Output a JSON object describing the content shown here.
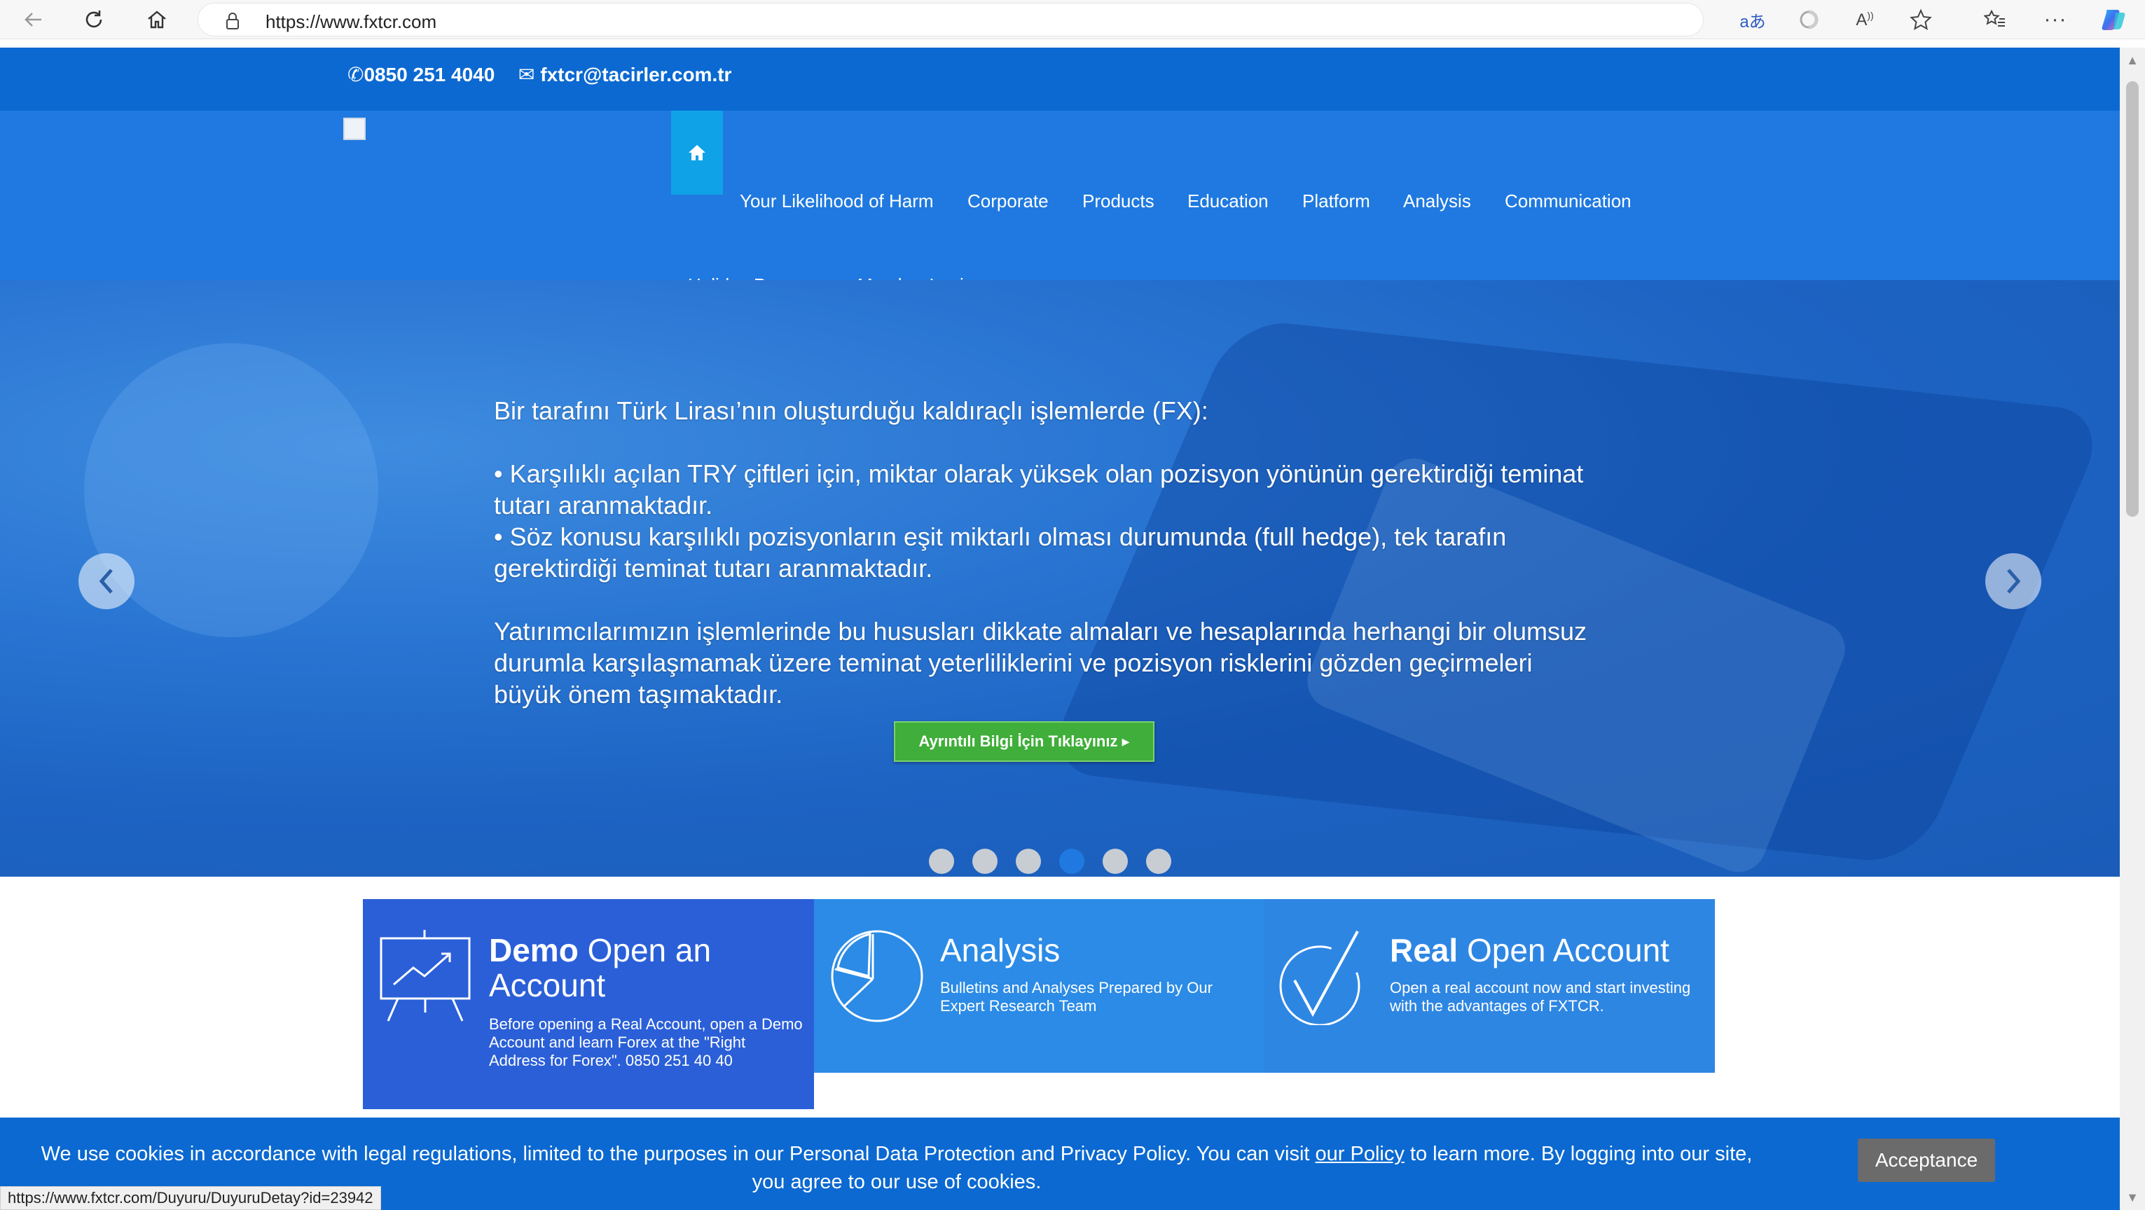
{
  "browser": {
    "url": "https://www.fxtcr.com"
  },
  "topbar": {
    "phone": "0850 251 4040",
    "email": "fxtcr@tacirler.com.tr"
  },
  "nav": {
    "items": [
      {
        "label": "Your Likelihood of Harm"
      },
      {
        "label": "Corporate"
      },
      {
        "label": "Products"
      },
      {
        "label": "Education"
      },
      {
        "label": "Platform"
      },
      {
        "label": "Analysis"
      },
      {
        "label": "Communication"
      },
      {
        "label": "Holiday Program"
      },
      {
        "label": "Member Login"
      }
    ]
  },
  "hero": {
    "line1": "Bir tarafını Türk Lirası’nın oluşturduğu kaldıraçlı işlemlerde (FX):",
    "bullet1": "• Karşılıklı açılan TRY çiftleri için, miktar olarak yüksek olan pozisyon yönünün gerektirdiği teminat tutarı aranmaktadır.",
    "bullet2": "• Söz konusu karşılıklı pozisyonların eşit miktarlı olması durumunda (full hedge), tek tarafın gerektirdiği teminat tutarı aranmaktadır.",
    "paragraph": "Yatırımcılarımızın işlemlerinde bu hususları dikkate almaları ve hesaplarında herhangi bir olumsuz durumla karşılaşmamak üzere teminat yeterliliklerini ve pozisyon risklerini gözden geçirmeleri büyük önem taşımaktadır.",
    "cta": "Ayrıntılı Bilgi İçin Tıklayınız",
    "slide_count": 6,
    "active_slide": 4
  },
  "features": [
    {
      "title_bold": "Demo",
      "title_rest": " Open an Account",
      "desc": "Before opening a Real Account, open a Demo Account and learn Forex at the \"Right Address for Forex\". 0850 251 40 40",
      "color": "#2a5fd8",
      "icon": "presentation-chart-icon"
    },
    {
      "title_bold": "",
      "title_rest": "Analysis",
      "desc": "Bulletins and Analyses Prepared by Our Expert Research Team",
      "color": "#2b8be6",
      "icon": "pie-chart-icon"
    },
    {
      "title_bold": "Real",
      "title_rest": " Open Account",
      "desc": "Open a real account now and start investing with the advantages of FXTCR.",
      "color": "#2e86e3",
      "icon": "checkmark-icon"
    }
  ],
  "cookie": {
    "text_before": "We use cookies in accordance with legal regulations, limited to the purposes in our Personal Data Protection and Privacy Policy. You can visit ",
    "link": "our Policy",
    "text_after": " to learn more. By logging into our site, you agree to our use of cookies.",
    "button": "Acceptance"
  },
  "status_url": "https://www.fxtcr.com/Duyuru/DuyuruDetay?id=23942",
  "colors": {
    "topbar": "#0b69d1",
    "nav": "#1f79e0",
    "home_tab": "#0fa2e6",
    "cta_green": "#3fae3a"
  }
}
